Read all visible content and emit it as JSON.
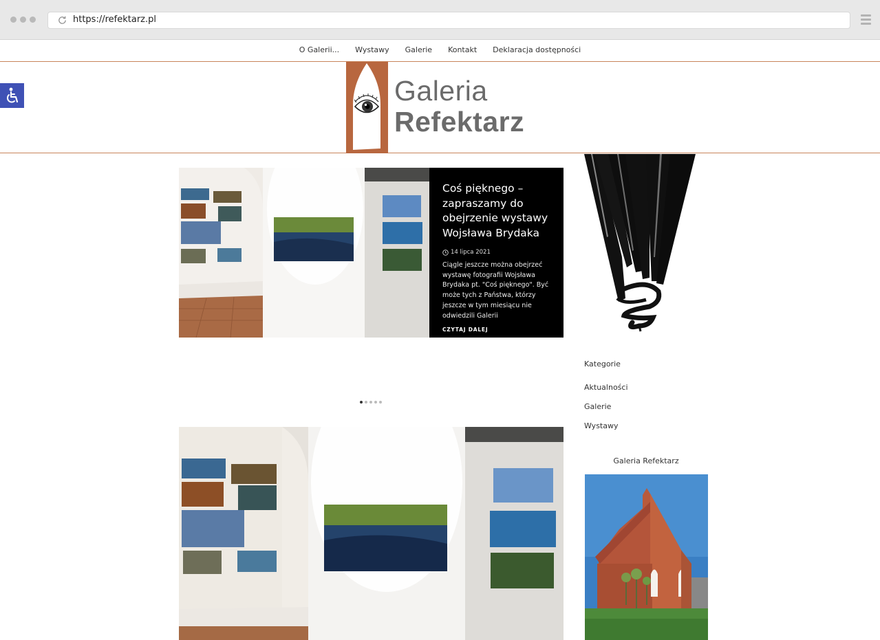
{
  "browser": {
    "url": "https://refektarz.pl"
  },
  "nav": {
    "items": [
      "O Galerii...",
      "Wystawy",
      "Galerie",
      "Kontakt",
      "Deklaracja dostępności"
    ]
  },
  "logo": {
    "line1": "Galeria",
    "line2": "Refektarz"
  },
  "slider": {
    "title": "Coś pięknego – zapraszamy do obejrzenie wystawy Wojsława Brydaka",
    "date": "14 lipca 2021",
    "excerpt": "Ciągle jeszcze można obejrzeć wystawę fotografii Wojsława Brydaka pt. \"Coś pięknego\". Być może tych z Państwa, którzy jeszcze w tym miesiącu nie odwiedzili Galerii",
    "read_more": "CZYTAJ DALEJ",
    "pages": 5,
    "active_page": 1
  },
  "sidebar": {
    "categories_title": "Kategorie",
    "categories": [
      "Aktualności",
      "Galerie",
      "Wystawy"
    ],
    "gallery_title": "Galeria Refektarz"
  },
  "colors": {
    "accent": "#c8845a",
    "a11y_button": "#3f51b5",
    "panel": "#000000"
  }
}
